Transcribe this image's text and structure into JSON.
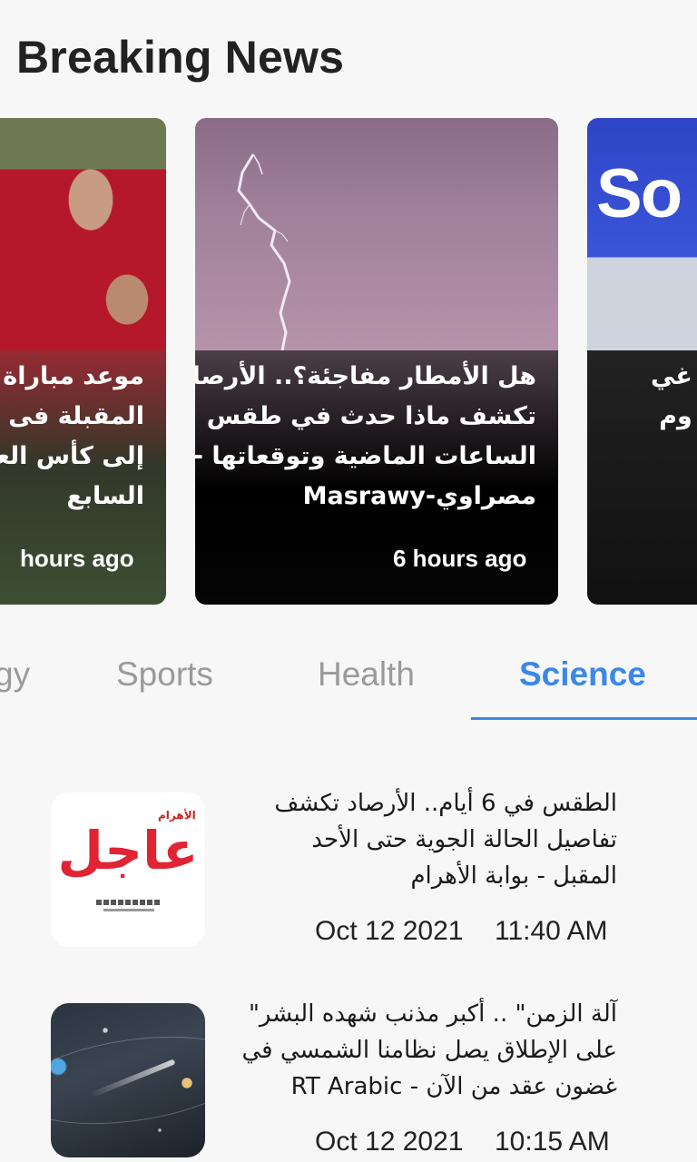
{
  "section_title": "Breaking News",
  "carousel": [
    {
      "headline_lines": [
        "موعد مباراة مصر",
        "المقبلة فى التصفيات",
        "إلى كأس العالم",
        "السابع"
      ],
      "time": "hours ago"
    },
    {
      "headline_lines": [
        "هل الأمطار مفاجئة؟.. الأرصاد",
        "تكشف ماذا حدث في طقس",
        "الساعات الماضية وتوقعاتها -",
        "مصراوي-Masrawy"
      ],
      "time": "6 hours ago"
    },
    {
      "headline_lines": [
        "غي",
        "وم"
      ],
      "logo_text": "So"
    }
  ],
  "tabs": [
    {
      "label": "gy"
    },
    {
      "label": "Sports"
    },
    {
      "label": "Health"
    },
    {
      "label": "Science",
      "active": true
    }
  ],
  "articles": [
    {
      "title_lines": [
        "الطقس في 6 أيام.. الأرصاد تكشف",
        "تفاصيل الحالة الجوية حتى الأحد",
        "المقبل - بوابة الأهرام"
      ],
      "date": "Oct 12 2021",
      "time": "11:40 AM",
      "thumb_brand": "عاجل",
      "thumb_brand_small": "الأهرام"
    },
    {
      "title_lines": [
        "آلة الزمن\" .. أكبر مذنب شهده البشر\"",
        "على الإطلاق يصل نظامنا الشمسي في",
        "غضون عقد من الآن - RT Arabic"
      ],
      "date": "Oct 12 2021",
      "time": "10:15 AM"
    }
  ],
  "colors": {
    "accent": "#3b88e8",
    "tab_inactive": "#9a9a9a",
    "background": "#f7f7f8"
  }
}
